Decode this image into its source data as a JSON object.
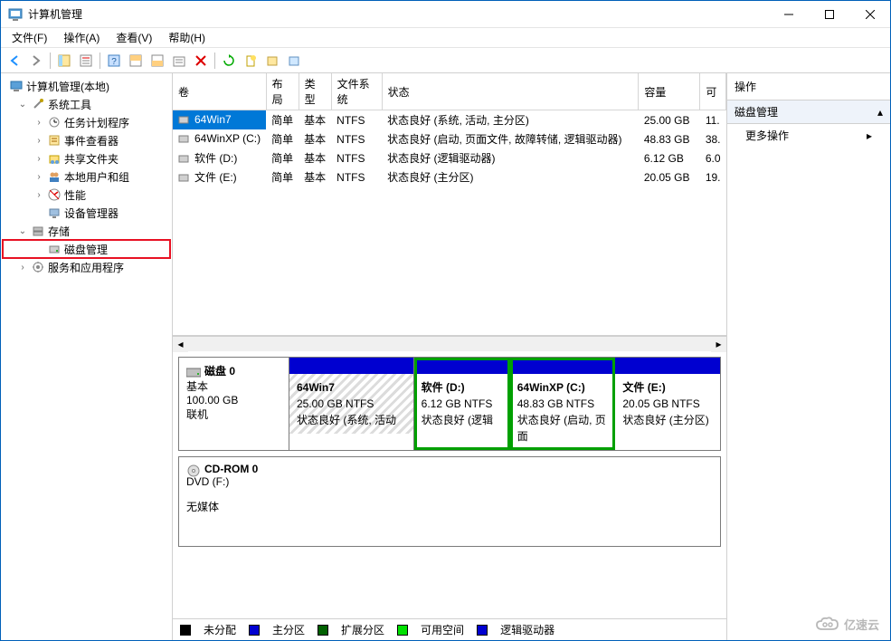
{
  "window": {
    "title": "计算机管理"
  },
  "menus": {
    "file": "文件(F)",
    "action": "操作(A)",
    "view": "查看(V)",
    "help": "帮助(H)"
  },
  "tree": {
    "root": "计算机管理(本地)",
    "systools": "系统工具",
    "taskSched": "任务计划程序",
    "eventViewer": "事件查看器",
    "sharedFolders": "共享文件夹",
    "localUsers": "本地用户和组",
    "performance": "性能",
    "deviceMgr": "设备管理器",
    "storage": "存储",
    "diskMgmt": "磁盘管理",
    "services": "服务和应用程序"
  },
  "cols": {
    "volume": "卷",
    "layout": "布局",
    "type": "类型",
    "fs": "文件系统",
    "status": "状态",
    "capacity": "容量",
    "free": "可"
  },
  "vols": [
    {
      "name": "64Win7",
      "layout": "简单",
      "type": "基本",
      "fs": "NTFS",
      "status": "状态良好 (系统, 活动, 主分区)",
      "cap": "25.00 GB",
      "free": "11."
    },
    {
      "name": "64WinXP  (C:)",
      "layout": "简单",
      "type": "基本",
      "fs": "NTFS",
      "status": "状态良好 (启动, 页面文件, 故障转储, 逻辑驱动器)",
      "cap": "48.83 GB",
      "free": "38."
    },
    {
      "name": "软件 (D:)",
      "layout": "简单",
      "type": "基本",
      "fs": "NTFS",
      "status": "状态良好 (逻辑驱动器)",
      "cap": "6.12 GB",
      "free": "6.0"
    },
    {
      "name": "文件 (E:)",
      "layout": "简单",
      "type": "基本",
      "fs": "NTFS",
      "status": "状态良好 (主分区)",
      "cap": "20.05 GB",
      "free": "19."
    }
  ],
  "disk0": {
    "label": "磁盘 0",
    "type": "基本",
    "size": "100.00 GB",
    "status": "联机",
    "parts": [
      {
        "name": "64Win7",
        "size": "25.00 GB NTFS",
        "status": "状态良好 (系统, 活动"
      },
      {
        "name": "软件  (D:)",
        "size": "6.12 GB NTFS",
        "status": "状态良好 (逻辑"
      },
      {
        "name": "64WinXP   (C:)",
        "size": "48.83 GB NTFS",
        "status": "状态良好 (启动, 页面"
      },
      {
        "name": "文件  (E:)",
        "size": "20.05 GB NTFS",
        "status": "状态良好 (主分区)"
      }
    ]
  },
  "cdrom": {
    "label": "CD-ROM 0",
    "drive": "DVD (F:)",
    "status": "无媒体"
  },
  "legend": {
    "unalloc": "未分配",
    "primary": "主分区",
    "extended": "扩展分区",
    "free": "可用空间",
    "logical": "逻辑驱动器"
  },
  "actions": {
    "header": "操作",
    "diskMgmt": "磁盘管理",
    "more": "更多操作"
  },
  "watermark": "亿速云"
}
